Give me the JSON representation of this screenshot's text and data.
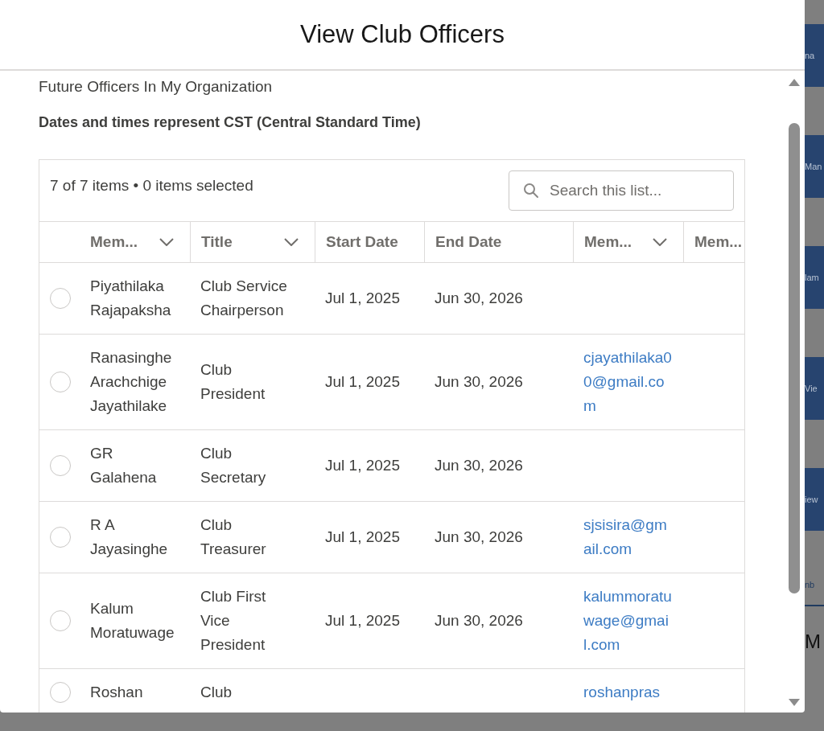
{
  "background_page": {
    "buttons": [
      "na",
      "Man",
      "lam",
      "Vie",
      "iew"
    ],
    "tab": "nb",
    "heading": "M"
  },
  "modal": {
    "title": "View Club Officers",
    "subtitle": "Future Officers In My Organization",
    "note": "Dates and times represent CST (Central Standard Time)"
  },
  "table": {
    "summary": "7 of 7 items • 0 items selected",
    "search": {
      "placeholder": "Search this list..."
    },
    "columns": [
      {
        "label": "Mem...",
        "sortable": true,
        "kind": "text"
      },
      {
        "label": "Title",
        "sortable": true,
        "kind": "text"
      },
      {
        "label": "Start Date",
        "sortable": false,
        "kind": "text"
      },
      {
        "label": "End Date",
        "sortable": false,
        "kind": "text"
      },
      {
        "label": "Mem...",
        "sortable": true,
        "kind": "link"
      },
      {
        "label": "Mem..."
      }
    ],
    "rows": [
      {
        "selected": false,
        "cells": [
          "Piyathilaka Rajapaksha",
          "Club Service Chairperson",
          "Jul 1, 2025",
          "Jun 30, 2026",
          "",
          ""
        ]
      },
      {
        "selected": false,
        "cells": [
          "Ranasinghe Arachchige Jayathilake",
          "Club President",
          "Jul 1, 2025",
          "Jun 30, 2026",
          "cjayathilaka00@gmail.com",
          ""
        ]
      },
      {
        "selected": false,
        "cells": [
          "GR Galahena",
          "Club Secretary",
          "Jul 1, 2025",
          "Jun 30, 2026",
          "",
          ""
        ]
      },
      {
        "selected": false,
        "cells": [
          "R A Jayasinghe",
          "Club Treasurer",
          "Jul 1, 2025",
          "Jun 30, 2026",
          "sjsisira@gmail.com",
          ""
        ]
      },
      {
        "selected": false,
        "cells": [
          "Kalum Moratuwage",
          "Club First Vice President",
          "Jul 1, 2025",
          "Jun 30, 2026",
          "kalummoratuwage@gmail.com",
          ""
        ]
      },
      {
        "selected": false,
        "cells": [
          "Roshan",
          "Club",
          "",
          "",
          "roshanpras",
          ""
        ]
      }
    ]
  }
}
